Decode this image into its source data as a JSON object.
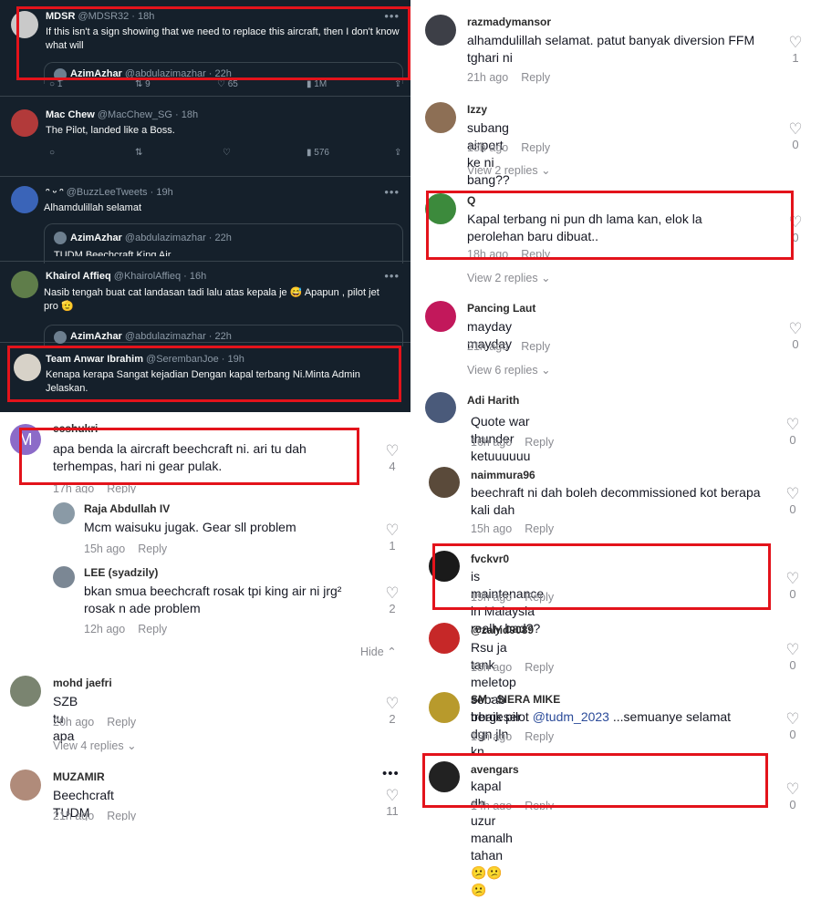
{
  "twitter": {
    "tweets": [
      {
        "name": "MDSR",
        "handle": "@MDSR32 · 18h",
        "text": "If this isn't a sign showing that we need to replace this aircraft, then I don't know what will",
        "quote_name": "AzimAzhar",
        "quote_handle": "@abdulazimazhar · 22h",
        "replies": "1",
        "retweets": "9",
        "likes": "65",
        "views": "1M"
      },
      {
        "name": "Mac Chew",
        "handle": "@MacChew_SG · 18h",
        "text": "The Pilot, landed like a Boss.",
        "views": "576"
      },
      {
        "name": "ᵔ ᵕ ᵔ",
        "handle": "@BuzzLeeTweets · 19h",
        "text": "Alhamdulillah selamat",
        "quote_name": "AzimAzhar",
        "quote_handle": "@abdulazimazhar · 22h",
        "quote_text": "TUDM Beechcraft King Air"
      },
      {
        "name": "Khairol Affieq",
        "handle": "@KhairolAffieq · 16h",
        "text": "Nasib tengah buat cat landasan tadi lalu atas kepala je 😅 Apapun , pilot jet pro 🫡",
        "quote_name": "AzimAzhar",
        "quote_handle": "@abdulazimazhar · 22h"
      },
      {
        "name": "Team Anwar Ibrahim",
        "handle": "@SerembanJoe · 19h",
        "text": "Kenapa kerapa Sangat kejadian Dengan kapal terbang Ni.Minta Admin Jelaskan."
      }
    ]
  },
  "left_comments": [
    {
      "name": "ecshukri",
      "text": "apa benda la aircraft beechcraft ni. ari tu dah terhempas, hari ni gear pulak.",
      "time": "17h ago",
      "reply": "Reply",
      "likes": "4",
      "avatar_letter": "M"
    },
    {
      "name": "Raja Abdullah IV",
      "text": "Mcm waisuku jugak. Gear sll problem",
      "time": "15h ago",
      "reply": "Reply",
      "likes": "1"
    },
    {
      "name": "LEE (syadzily)",
      "text": "bkan smua beechcraft rosak tpi king air ni jrg² rosak n ade problem",
      "time": "12h ago",
      "reply": "Reply",
      "likes": "2"
    },
    {
      "name": "mohd jaefri",
      "text": "SZB tu apa",
      "time": "20h ago",
      "reply": "Reply",
      "likes": "2"
    },
    {
      "name": "MUZAMIR",
      "text": "Beechcraft TUDM",
      "time": "21h ago",
      "reply": "Reply",
      "likes": "11"
    }
  ],
  "left_misc": {
    "hide_label": "Hide",
    "view_replies": "View 4 replies"
  },
  "right_comments": [
    {
      "name": "razmadymansor",
      "text": "alhamdulillah selamat. patut banyak diversion FFM tghari ni",
      "time": "21h ago",
      "reply": "Reply",
      "likes": "1"
    },
    {
      "name": "Izzy",
      "text": "subang airport ke ni bang??",
      "time": "18h ago",
      "reply": "Reply",
      "likes": "0",
      "view_replies": "View 2 replies"
    },
    {
      "name": "Q",
      "text": "Kapal terbang ni pun dh lama kan, elok la perolehan baru dibuat..",
      "time": "18h ago",
      "reply": "Reply",
      "likes": "0",
      "view_replies": "View 2 replies"
    },
    {
      "name": "Pancing Laut",
      "text": "mayday mayday",
      "time": "21h ago",
      "reply": "Reply",
      "likes": "0",
      "view_replies": "View 6 replies"
    },
    {
      "name": "Adi Harith",
      "text": "Quote war thunder ketuuuuuu",
      "time": "16h ago",
      "reply": "Reply",
      "likes": "0"
    },
    {
      "name": "naimmura96",
      "text": "beechraft ni dah boleh decommissioned kot berapa kali dah",
      "time": "15h ago",
      "reply": "Reply",
      "likes": "0"
    },
    {
      "name": "fvckvr0",
      "text": "is maintenance in Malaysia really bad??",
      "time": "19h ago",
      "reply": "Reply",
      "likes": "0"
    },
    {
      "name": "@zahid9089",
      "text": "Rsu ja tank meletop sebab bergeser dgn jln kn",
      "time": "15h ago",
      "reply": "Reply",
      "likes": "0"
    },
    {
      "name": "SM : SIERA MIKE",
      "text_pre": "trbaik pilot ",
      "mention": "@tudm_2023",
      "text_post": " ...semuanye selamat",
      "time": "15h ago",
      "reply": "Reply",
      "likes": "0"
    },
    {
      "name": "avengars",
      "text": "kapal dh uzur manalh tahan😕😕😕",
      "time": "14h ago",
      "reply": "Reply",
      "likes": "0"
    }
  ],
  "colors": {
    "highlight": "#e3131b",
    "twitter_bg": "#15202b",
    "mention": "#2b4b99"
  }
}
